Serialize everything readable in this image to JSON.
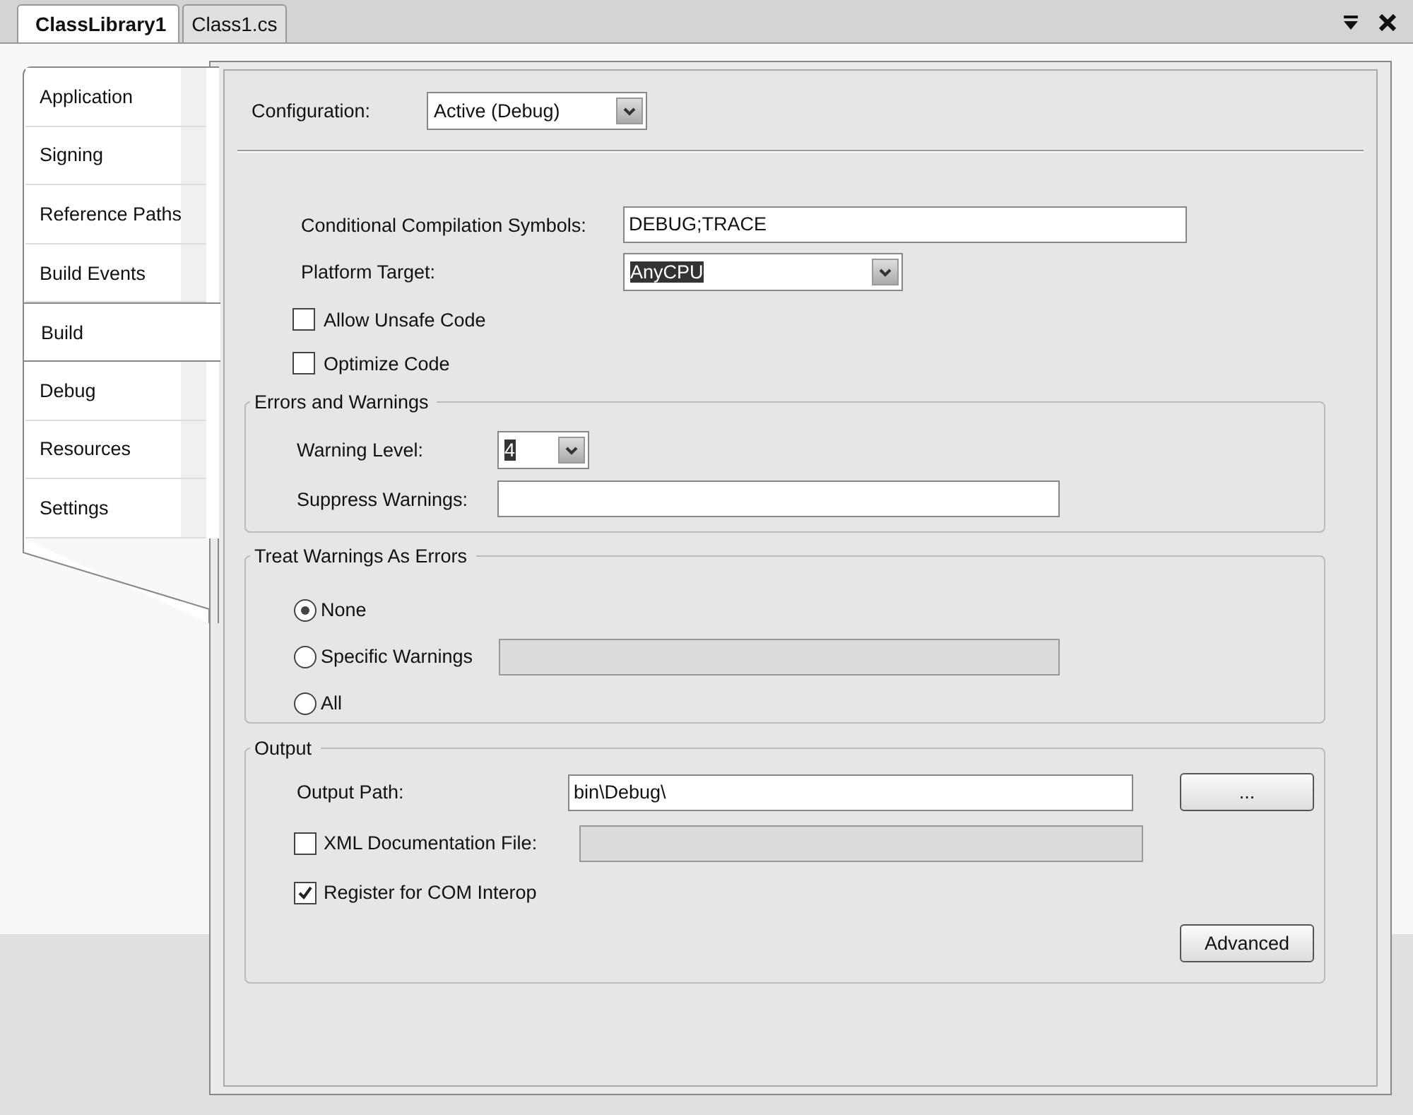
{
  "doc_tabs": [
    {
      "label": "ClassLibrary1",
      "selected": true
    },
    {
      "label": "Class1.cs",
      "selected": false
    }
  ],
  "sidebar": {
    "items": [
      {
        "label": "Application",
        "selected": false
      },
      {
        "label": "Signing",
        "selected": false
      },
      {
        "label": "Reference Paths",
        "selected": false
      },
      {
        "label": "Build Events",
        "selected": false
      },
      {
        "label": "Build",
        "selected": true
      },
      {
        "label": "Debug",
        "selected": false
      },
      {
        "label": "Resources",
        "selected": false
      },
      {
        "label": "Settings",
        "selected": false
      }
    ]
  },
  "configuration": {
    "label": "Configuration:",
    "value": "Active (Debug)"
  },
  "general": {
    "symbols_label": "Conditional Compilation Symbols:",
    "symbols_value": "DEBUG;TRACE",
    "platform_label": "Platform Target:",
    "platform_value": "AnyCPU",
    "platform_highlighted": true,
    "checkboxes": [
      {
        "label": "Allow Unsafe Code",
        "checked": false
      },
      {
        "label": "Optimize Code",
        "checked": false
      }
    ]
  },
  "errors_and_warnings": {
    "title": "Errors and Warnings",
    "warning_level_label": "Warning Level:",
    "warning_level_value": "4",
    "warning_level_highlighted": true,
    "suppress_label": "Suppress Warnings:"
  },
  "treat_warnings_as_errors": {
    "title": "Treat Warnings As Errors",
    "options": [
      {
        "label": "None",
        "selected": true,
        "kind": "plain"
      },
      {
        "label": "Specific Warnings",
        "selected": false,
        "kind": "with_field"
      },
      {
        "label": "All",
        "selected": false,
        "kind": "plain"
      }
    ]
  },
  "output": {
    "title": "Output",
    "path_label": "Output Path:",
    "path_value": "bin\\Debug\\",
    "browse_button": "...",
    "checkboxes": [
      {
        "label": "XML Documentation File:",
        "checked": false,
        "kind": "with_field"
      },
      {
        "label": "Register for COM Interop",
        "checked": true,
        "kind": "plain"
      }
    ],
    "advanced_button": "Advanced"
  }
}
